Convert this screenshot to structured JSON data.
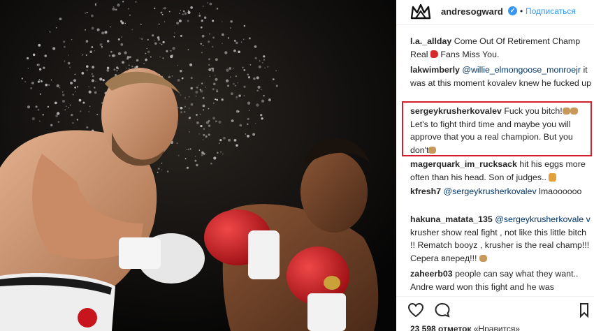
{
  "post": {
    "username": "andresogward",
    "verified_mark": "✓",
    "separator": "•",
    "follow_label": "Подписаться",
    "likes_count": "23 598",
    "likes_word": "отметок",
    "likes_more": "«Нравится»"
  },
  "comments": [
    {
      "user": "l.a._allday",
      "parts": [
        {
          "t": "text",
          "v": " Come Out Of Retirement Champ Real "
        },
        {
          "t": "emoji",
          "v": "boxing-glove-emoji"
        },
        {
          "t": "text",
          "v": " Fans Miss You."
        }
      ]
    },
    {
      "user": "lakwimberly",
      "parts": [
        {
          "t": "text",
          "v": " "
        },
        {
          "t": "mention",
          "v": "@willie_elmongoose_monroejr"
        },
        {
          "t": "text",
          "v": " it was at this moment kovalev knew he fucked up"
        }
      ]
    },
    {
      "user": "sergeykrusherkovalev",
      "parts": [
        {
          "t": "text",
          "v": " Fuck you bitch!"
        },
        {
          "t": "emoji",
          "v": "fist-emoji"
        },
        {
          "t": "emoji",
          "v": "fist-emoji"
        },
        {
          "t": "text",
          "v": "Let's to fight third time and maybe you will approve that you a real champion. But you don't"
        },
        {
          "t": "emoji",
          "v": "fist-emoji"
        }
      ]
    },
    {
      "user": "magerquark_im_rucksack",
      "parts": [
        {
          "t": "text",
          "v": " hit his eggs more often than his head. Son of judges.. "
        },
        {
          "t": "emoji",
          "v": "thumbs-down-emoji"
        }
      ]
    },
    {
      "user": "kfresh7",
      "parts": [
        {
          "t": "text",
          "v": " "
        },
        {
          "t": "mention",
          "v": "@sergeykrusherkovalev"
        },
        {
          "t": "text",
          "v": " lmaoooooo"
        }
      ]
    },
    {
      "user": "hakuna_matata_135",
      "parts": [
        {
          "t": "text",
          "v": " "
        },
        {
          "t": "mention",
          "v": "@sergeykrusherkovale v"
        },
        {
          "t": "text",
          "v": " krusher show real fight , not like this little bitch !! Rematch booyz , krusher is the real champ!!! Серега вперед!!! "
        },
        {
          "t": "emoji",
          "v": "fist-emoji"
        }
      ]
    },
    {
      "user": "zaheerb03",
      "parts": [
        {
          "t": "text",
          "v": " people can say what they want.. Andre ward won this fight and he was"
        }
      ]
    }
  ],
  "icons": {
    "avatar": "crown-logo",
    "like": "heart-icon",
    "comment": "speech-bubble-icon",
    "save": "bookmark-icon"
  },
  "colors": {
    "accent": "#3897f0",
    "highlight_border": "#d21f2b",
    "text": "#262626"
  }
}
